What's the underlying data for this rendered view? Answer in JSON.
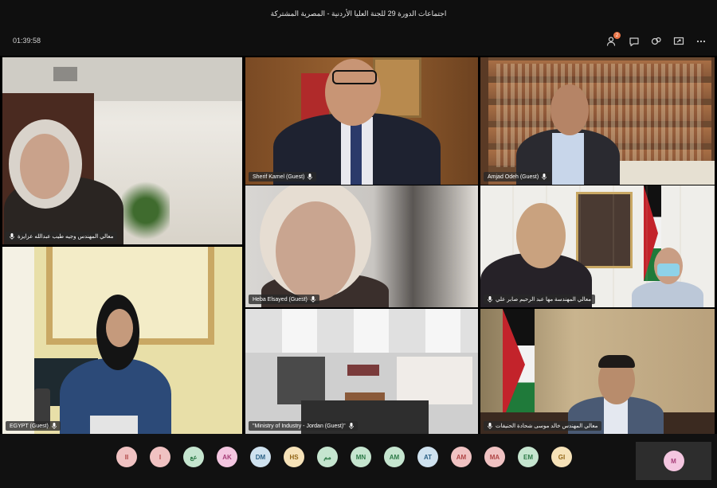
{
  "window": {
    "title": "اجتماعات الدورة 29 للجنة العليا الأردنية - المصرية المشتركة"
  },
  "toolbar": {
    "timer": "01:39:58",
    "participants_badge": "2",
    "icons": [
      "people-icon",
      "chat-icon",
      "reactions-icon",
      "share-screen-icon",
      "more-options-icon"
    ]
  },
  "tiles": [
    {
      "name": "معالي المهندس وجيه طيب عبدالله عزايزة",
      "rtl": true
    },
    {
      "name": "Sherif Kamel (Guest)",
      "rtl": false
    },
    {
      "name": "Amjad Odeh (Guest)",
      "rtl": false
    },
    {
      "name": "Heba Elsayed (Guest)",
      "rtl": false
    },
    {
      "name": "معالي المهندسة مها عبد الرحيم صابر علي",
      "rtl": true
    },
    {
      "name": "EGYPT (Guest)",
      "rtl": false
    },
    {
      "name": "\"Ministry of Industry - Jordan (Guest)\"",
      "rtl": false
    },
    {
      "name": "معالي المهندس خالد موسى شحادة الحنيفات",
      "rtl": true
    }
  ],
  "participants": [
    {
      "initials": "II",
      "bg": "#f0c2c2",
      "fg": "#b04545"
    },
    {
      "initials": "I",
      "bg": "#f0c2c2",
      "fg": "#b04545"
    },
    {
      "initials": "عع",
      "bg": "#c5e5cf",
      "fg": "#2d7a47"
    },
    {
      "initials": "AK",
      "bg": "#f4c6e0",
      "fg": "#a8407a"
    },
    {
      "initials": "DM",
      "bg": "#cfe2ef",
      "fg": "#2e6387"
    },
    {
      "initials": "HS",
      "bg": "#f6e2b8",
      "fg": "#926516"
    },
    {
      "initials": "مم",
      "bg": "#c5e5cf",
      "fg": "#2d7a47"
    },
    {
      "initials": "MN",
      "bg": "#c5e5cf",
      "fg": "#2d7a47"
    },
    {
      "initials": "AM",
      "bg": "#c5e5cf",
      "fg": "#2d7a47"
    },
    {
      "initials": "AT",
      "bg": "#cfe2ef",
      "fg": "#2e6387"
    },
    {
      "initials": "AM",
      "bg": "#f0c2c2",
      "fg": "#b04545"
    },
    {
      "initials": "MA",
      "bg": "#f0c2c2",
      "fg": "#b04545"
    },
    {
      "initials": "EM",
      "bg": "#c5e5cf",
      "fg": "#2d7a47"
    },
    {
      "initials": "GI",
      "bg": "#f6e2b8",
      "fg": "#926516"
    }
  ],
  "self": {
    "initials": "M",
    "bg": "#f4c6e0",
    "fg": "#a8407a"
  }
}
